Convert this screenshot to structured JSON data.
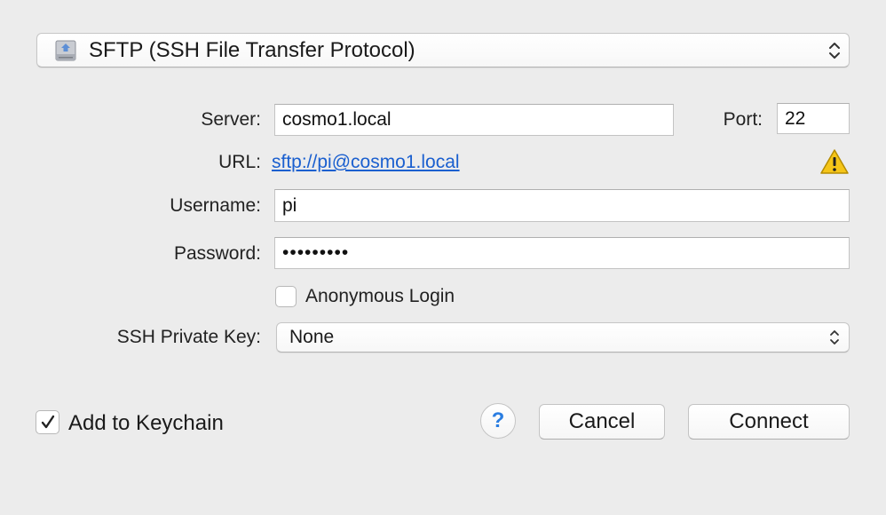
{
  "protocol": {
    "selected": "SFTP (SSH File Transfer Protocol)",
    "icon": "drive-icon"
  },
  "server": {
    "label": "Server:",
    "value": "cosmo1.local"
  },
  "port": {
    "label": "Port:",
    "value": "22"
  },
  "url": {
    "label": "URL:",
    "value": "sftp://pi@cosmo1.local",
    "warning_icon": "warning-icon"
  },
  "username": {
    "label": "Username:",
    "value": "pi"
  },
  "password": {
    "label": "Password:",
    "value": "•••••••••"
  },
  "anonymous": {
    "label": "Anonymous Login",
    "checked": false
  },
  "ssh_key": {
    "label": "SSH Private Key:",
    "selected": "None"
  },
  "keychain": {
    "label": "Add to Keychain",
    "checked": true
  },
  "buttons": {
    "help": "?",
    "cancel": "Cancel",
    "connect": "Connect"
  },
  "colors": {
    "background": "#ececec",
    "link": "#1a5fcf",
    "warning": "#f5c518",
    "help": "#2a7de1"
  }
}
